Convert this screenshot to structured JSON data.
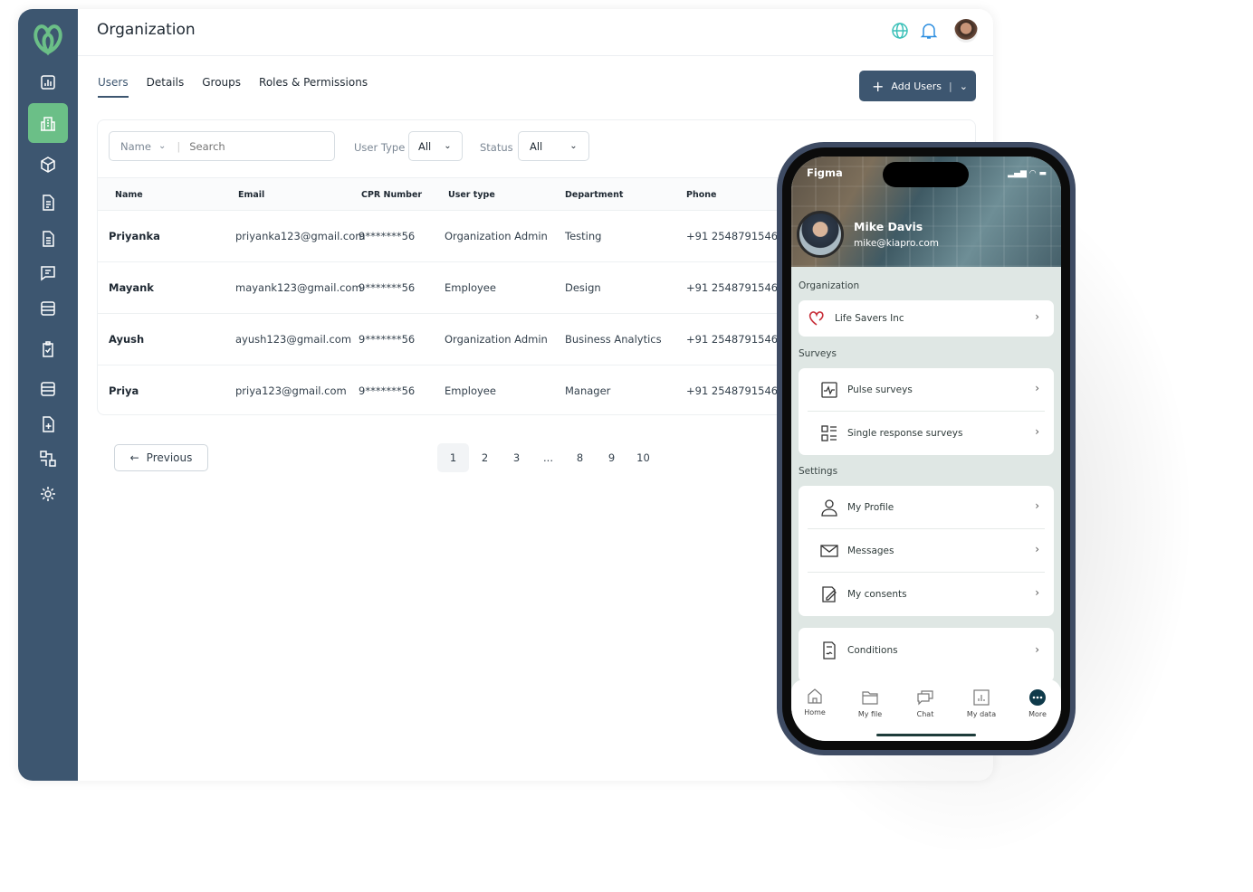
{
  "app": {
    "title": "Organization"
  },
  "tabs": [
    {
      "label": "Users"
    },
    {
      "label": "Details"
    },
    {
      "label": "Groups"
    },
    {
      "label": "Roles & Permissions"
    }
  ],
  "add_button": {
    "label": "Add Users"
  },
  "filters": {
    "name_select": "Name",
    "search_placeholder": "Search",
    "user_type_label": "User Type",
    "user_type_value": "All",
    "status_label": "Status",
    "status_value": "All"
  },
  "table": {
    "columns": [
      "Name",
      "Email",
      "CPR Number",
      "User type",
      "Department",
      "Phone"
    ],
    "rows": [
      [
        "Priyanka",
        "priyanka123@gmail.com",
        "9*******56",
        "Organization Admin",
        "Testing",
        "+91 2548791546"
      ],
      [
        "Mayank",
        "mayank123@gmail.com",
        "9*******56",
        "Employee",
        "Design",
        "+91 2548791546"
      ],
      [
        "Ayush",
        "ayush123@gmail.com",
        "9*******56",
        "Organization Admin",
        "Business Analytics",
        "+91 2548791546"
      ],
      [
        "Priya",
        "priya123@gmail.com",
        "9*******56",
        "Employee",
        "Manager",
        "+91 2548791546"
      ]
    ]
  },
  "pagination": {
    "previous": "Previous",
    "pages": [
      "1",
      "2",
      "3",
      "...",
      "8",
      "9",
      "10"
    ],
    "current": "1"
  },
  "colors": {
    "sidebar": "#3d5670",
    "accent": "#6bbf87",
    "button": "#3d5670"
  },
  "phone": {
    "carrier": "Figma",
    "user_name": "Mike Davis",
    "user_email": "mike@kiapro.com",
    "sections": {
      "organization": "Organization",
      "surveys": "Surveys",
      "settings": "Settings"
    },
    "org_item": "Life Savers Inc",
    "survey_items": [
      "Pulse surveys",
      "Single response surveys"
    ],
    "settings_items": [
      "My Profile",
      "Messages",
      "My consents"
    ],
    "conditions": "Conditions",
    "tabbar": [
      "Home",
      "My file",
      "Chat",
      "My data",
      "More"
    ]
  }
}
